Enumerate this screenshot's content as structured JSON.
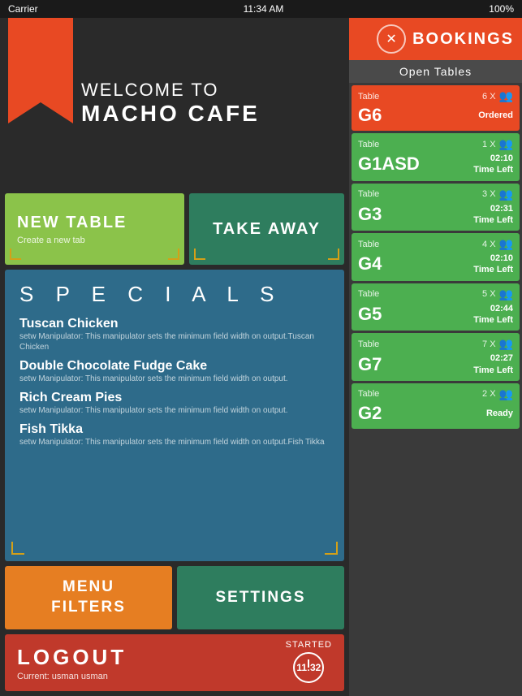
{
  "statusBar": {
    "carrier": "Carrier",
    "wifi": "WiFi",
    "time": "11:34 AM",
    "battery": "100%"
  },
  "header": {
    "welcomeLine": "WELCOME TO",
    "cafeName": "MACHO CAFE"
  },
  "buttons": {
    "newTable": "NEW TABLE",
    "newTableSub": "Create a new tab",
    "takeAway": "TAKE AWAY",
    "menuFilters": "MENU\nFILTERS",
    "settings": "SETTINGS"
  },
  "specials": {
    "title": "S P E C I A L S",
    "items": [
      {
        "name": "Tuscan Chicken",
        "desc": "setw Manipulator: This manipulator sets the minimum field width on output.Tuscan Chicken"
      },
      {
        "name": "Double Chocolate Fudge Cake",
        "desc": "setw Manipulator: This manipulator sets the minimum field width on output."
      },
      {
        "name": "Rich Cream Pies",
        "desc": "setw Manipulator: This manipulator sets the minimum field width on output."
      },
      {
        "name": "Fish Tikka",
        "desc": "setw Manipulator: This manipulator sets the minimum field width on output.Fish Tikka"
      }
    ]
  },
  "logout": {
    "label": "LOGOUT",
    "userLabel": "Current: usman usman",
    "startedLabel": "STARTED",
    "startedTime": "11:32"
  },
  "bookings": {
    "title": "BOOKINGS",
    "openTablesLabel": "Open Tables",
    "tables": [
      {
        "label": "Table",
        "count": "6 X",
        "name": "G6",
        "status": "Ordered",
        "type": "ordered"
      },
      {
        "label": "Table",
        "count": "1 X",
        "name": "G1ASD",
        "status": "02:10\nTime Left",
        "type": "active"
      },
      {
        "label": "Table",
        "count": "3 X",
        "name": "G3",
        "status": "02:31\nTime Left",
        "type": "active"
      },
      {
        "label": "Table",
        "count": "4 X",
        "name": "G4",
        "status": "02:10\nTime Left",
        "type": "active"
      },
      {
        "label": "Table",
        "count": "5 X",
        "name": "G5",
        "status": "02:44\nTime Left",
        "type": "active"
      },
      {
        "label": "Table",
        "count": "7 X",
        "name": "G7",
        "status": "02:27\nTime Left",
        "type": "active"
      },
      {
        "label": "Table",
        "count": "2 X",
        "name": "G2",
        "status": "Ready",
        "type": "ready"
      }
    ]
  }
}
